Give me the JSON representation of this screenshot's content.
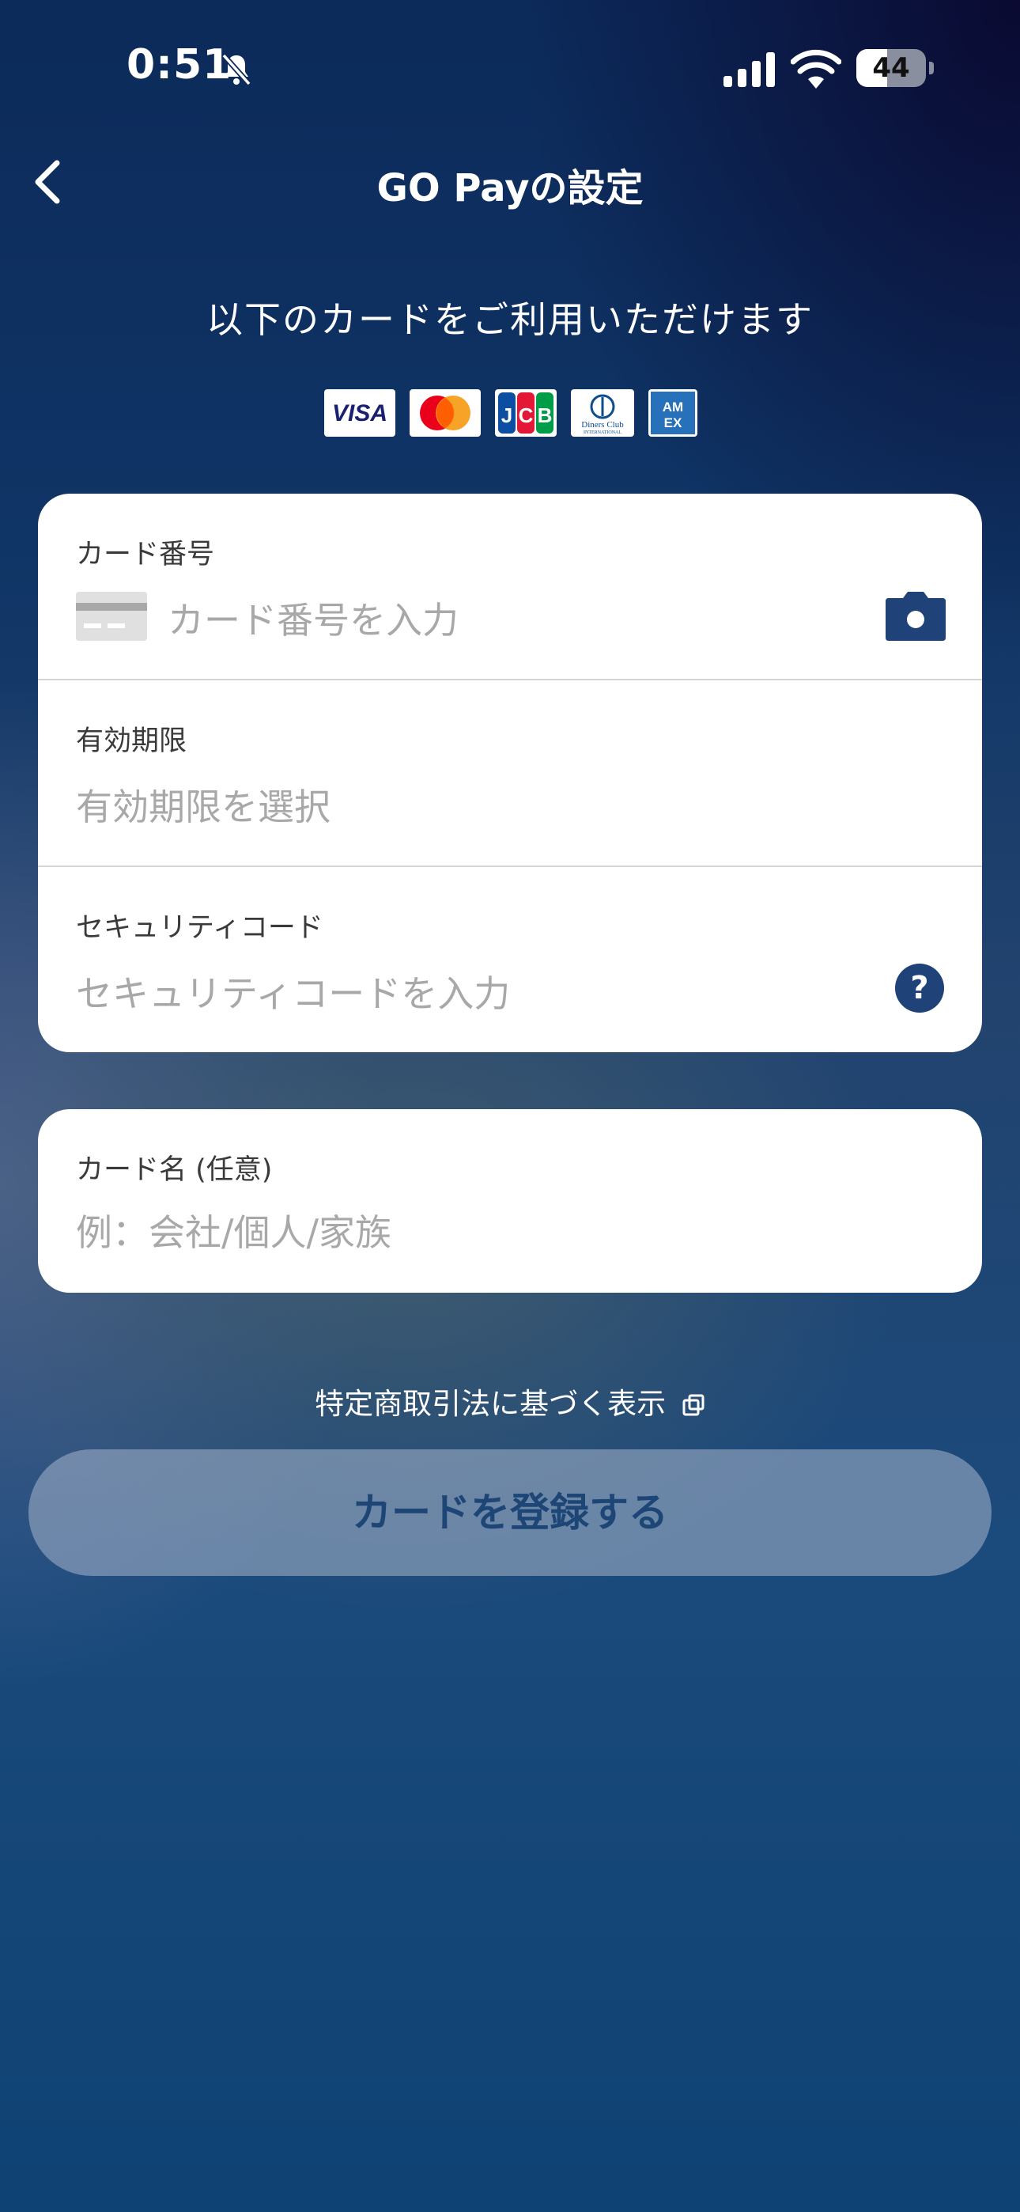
{
  "status_bar": {
    "time": "0:51",
    "battery": "44",
    "battery_level": 0.44
  },
  "nav": {
    "title": "GO Payの設定"
  },
  "accepted_cards": {
    "caption": "以下のカードをご利用いただけます",
    "brands": [
      "VISA",
      "Mastercard",
      "JCB",
      "Diners Club",
      "AMEX"
    ]
  },
  "form": {
    "card_number": {
      "label": "カード番号",
      "placeholder": "カード番号を入力"
    },
    "expiry": {
      "label": "有効期限",
      "placeholder": "有効期限を選択"
    },
    "security_code": {
      "label": "セキュリティコード",
      "placeholder": "セキュリティコードを入力",
      "help": "?"
    },
    "card_name": {
      "label": "カード名 (任意)",
      "placeholder": "例：会社/個人/家族"
    }
  },
  "legal_link": "特定商取引法に基づく表示",
  "register_button": "カードを登録する",
  "colors": {
    "accent": "#1f4378",
    "button_text": "#1d4677",
    "panel": "#ffffff"
  },
  "icons": {
    "back": "chevron-left-icon",
    "card": "credit-card-icon",
    "camera": "camera-icon",
    "help": "question-circle-icon",
    "external": "external-link-icon"
  }
}
